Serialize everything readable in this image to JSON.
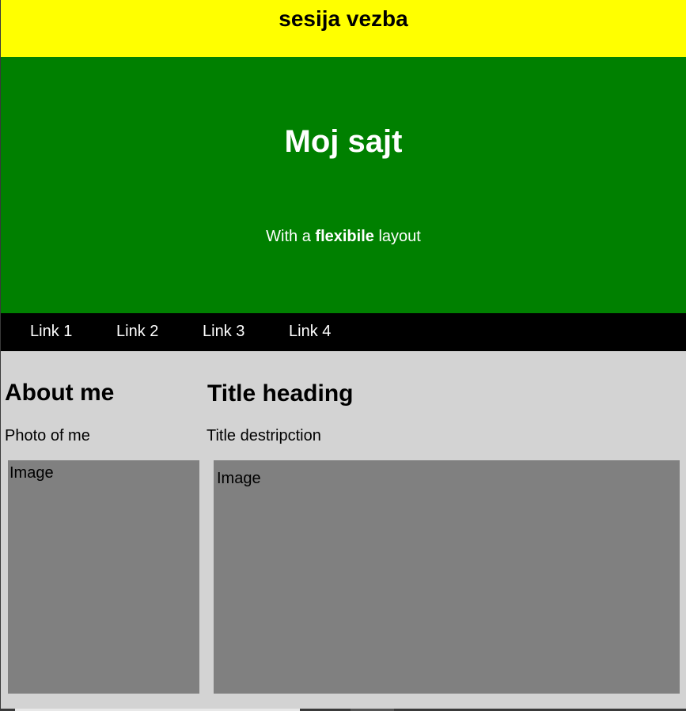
{
  "header": {
    "title": "sesija vezba"
  },
  "hero": {
    "title": "Moj sajt",
    "subtitle_pre": "With a ",
    "subtitle_bold": "flexibile",
    "subtitle_post": " layout"
  },
  "nav": {
    "links": [
      {
        "label": "Link 1"
      },
      {
        "label": "Link 2"
      },
      {
        "label": "Link 3"
      },
      {
        "label": "Link 4"
      }
    ]
  },
  "left": {
    "heading": "About me",
    "text": "Photo of me",
    "image_label": "Image"
  },
  "right": {
    "heading": "Title heading",
    "text": "Title destripction",
    "image_label": "Image"
  },
  "colors": {
    "header_bg": "#ffff00",
    "hero_bg": "#008000",
    "nav_bg": "#000000",
    "content_bg": "#d3d3d3",
    "image_bg": "#808080"
  }
}
